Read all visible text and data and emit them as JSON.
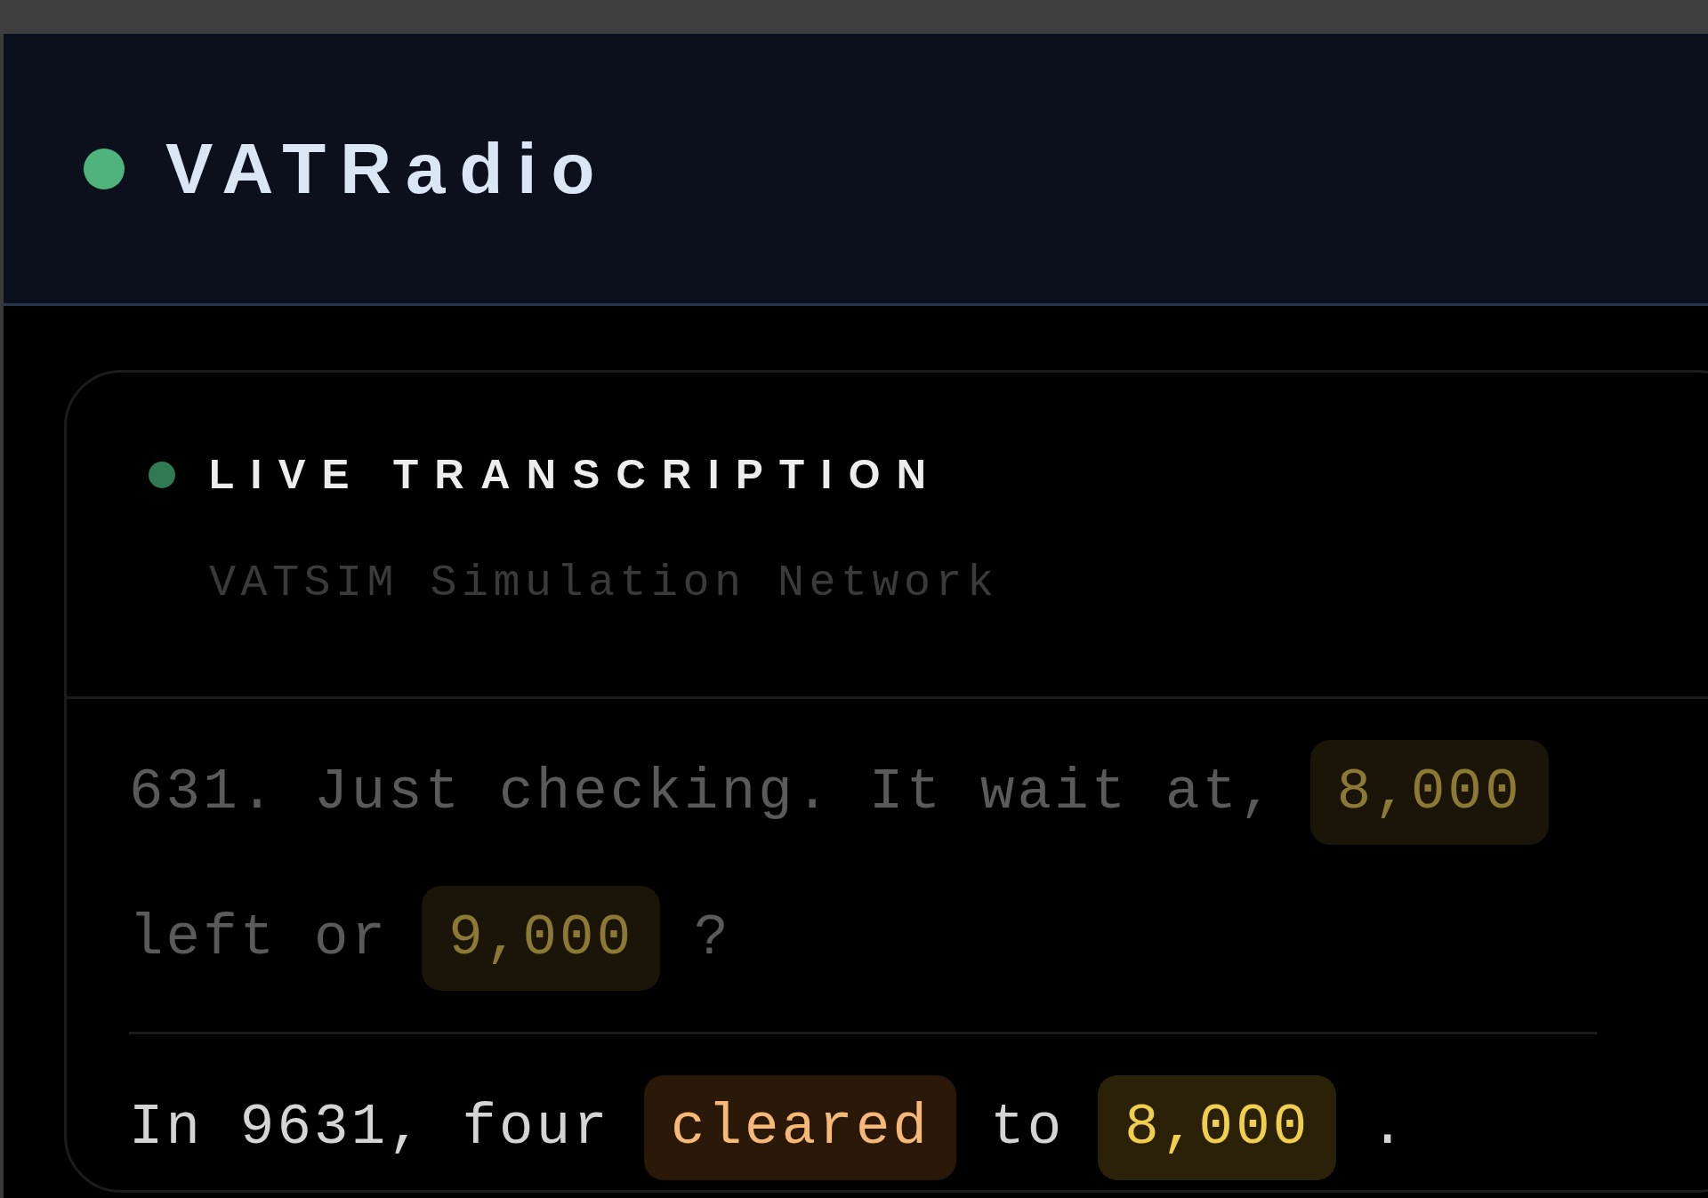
{
  "app": {
    "title": "VATRadio",
    "connected": true
  },
  "panel": {
    "title": "LIVE TRANSCRIPTION",
    "live": true,
    "subtitle": "VATSIM Simulation Network"
  },
  "messages": [
    {
      "recent": false,
      "segments": [
        {
          "kind": "text",
          "text": "631. Just checking. It wait at,"
        },
        {
          "kind": "altitude",
          "text": "8,000"
        },
        {
          "kind": "text",
          "text": "left or"
        },
        {
          "kind": "altitude",
          "text": "9,000"
        },
        {
          "kind": "text",
          "text": "?"
        }
      ]
    },
    {
      "recent": true,
      "segments": [
        {
          "kind": "text",
          "text": "In 9631, four"
        },
        {
          "kind": "instruction",
          "text": "cleared"
        },
        {
          "kind": "text",
          "text": "to"
        },
        {
          "kind": "altitude",
          "text": "8,000"
        },
        {
          "kind": "text",
          "text": "."
        }
      ]
    }
  ]
}
